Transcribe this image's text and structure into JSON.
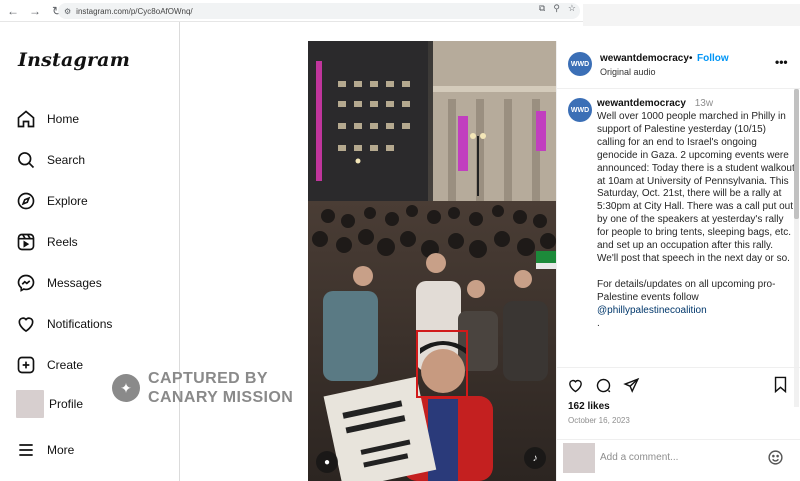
{
  "browser": {
    "url": "instagram.com/p/Cyc8oAfOWnq/",
    "back_icon": "arrow-left-icon",
    "forward_icon": "arrow-right-icon",
    "reload_icon": "reload-icon"
  },
  "sidebar": {
    "logo": "Instagram",
    "items": [
      {
        "label": "Home",
        "icon": "home-icon"
      },
      {
        "label": "Search",
        "icon": "search-icon"
      },
      {
        "label": "Explore",
        "icon": "compass-icon"
      },
      {
        "label": "Reels",
        "icon": "reels-icon"
      },
      {
        "label": "Messages",
        "icon": "messenger-icon"
      },
      {
        "label": "Notifications",
        "icon": "heart-icon"
      },
      {
        "label": "Create",
        "icon": "plus-square-icon"
      },
      {
        "label": "Profile",
        "icon": "avatar"
      },
      {
        "label": "More",
        "icon": "menu-icon"
      }
    ]
  },
  "watermark": {
    "line1": "CAPTURED BY",
    "line2": "CANARY MISSION"
  },
  "post": {
    "username": "wewantdemocracy",
    "avatar_text": "WWD",
    "follow_label": "Follow",
    "separator": "•",
    "audio": "Original audio",
    "more": "•••",
    "caption": {
      "username": "wewantdemocracy",
      "time": "13w",
      "body": "Well over 1000 people marched in Philly in support of Palestine yesterday (10/15) calling for an end to Israel's ongoing genocide in Gaza. 2 upcoming events were announced: Today there is a student walkout at 10am at University of Pennsylvania. This Saturday, Oct. 21st, there will be a rally at 5:30pm at City Hall. There was a call put out by one of the speakers at yesterday's rally for people to bring tents, sleeping bags, etc. and set up an occupation after this rally. We'll post that speech in the next day or so.",
      "details": "For details/updates on all upcoming pro-Palestine events follow",
      "mention": "@phillypalestinecoalition",
      "trailing": "."
    },
    "likes": "162 likes",
    "date": "October 16, 2023",
    "comment_placeholder": "Add a comment..."
  },
  "colors": {
    "accent": "#0095f6",
    "avatar_bg": "#3b6fb6",
    "watermark": "#8a8a8a",
    "highlight_box": "#d11a1a"
  }
}
